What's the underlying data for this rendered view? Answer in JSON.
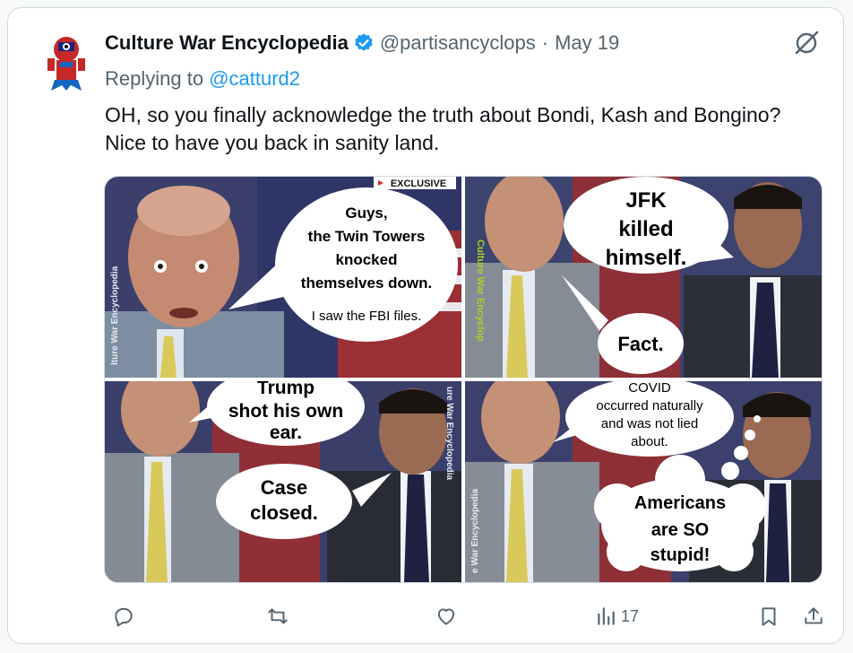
{
  "tweet": {
    "author_name": "Culture War Encyclopedia",
    "handle": "@partisancyclops",
    "separator": "·",
    "date": "May 19",
    "replying_prefix": "Replying to",
    "replying_to": "@catturd2",
    "text": "OH, so you finally acknowledge the truth about Bondi, Kash and Bongino? Nice to have you back in sanity land."
  },
  "media": {
    "panel1": {
      "badge": "EXCLUSIVE",
      "watermark": "lture War Encyclopedia",
      "bubble": [
        "Guys,",
        "the Twin Towers",
        "knocked",
        "themselves down."
      ],
      "bubble_small": "I saw the FBI files."
    },
    "panel2": {
      "watermark": "Culture War Encyclop",
      "bubble_main": [
        "JFK",
        "killed",
        "himself."
      ],
      "bubble_small": "Fact."
    },
    "panel3": {
      "watermark": "ure War Encyclopedia",
      "bubble_top": [
        "Trump",
        "shot his own",
        "ear."
      ],
      "bubble_bottom": [
        "Case",
        "closed."
      ]
    },
    "panel4": {
      "watermark": "e War Encyclopedia",
      "bubble_top": [
        "COVID",
        "occurred naturally",
        "and was not lied",
        "about."
      ],
      "bubble_bottom": [
        "Americans",
        "are SO",
        "stupid!"
      ]
    }
  },
  "actions": {
    "reply_icon": "reply-icon",
    "retweet_icon": "retweet-icon",
    "like_icon": "heart-icon",
    "views_icon": "views-icon",
    "views_count": "17",
    "bookmark_icon": "bookmark-icon",
    "share_icon": "share-icon"
  },
  "colors": {
    "accent": "#1d9bf0",
    "text_primary": "#0f1419",
    "text_secondary": "#536471",
    "verified": "#1d9bf0",
    "watermark_green": "#a7d129"
  }
}
